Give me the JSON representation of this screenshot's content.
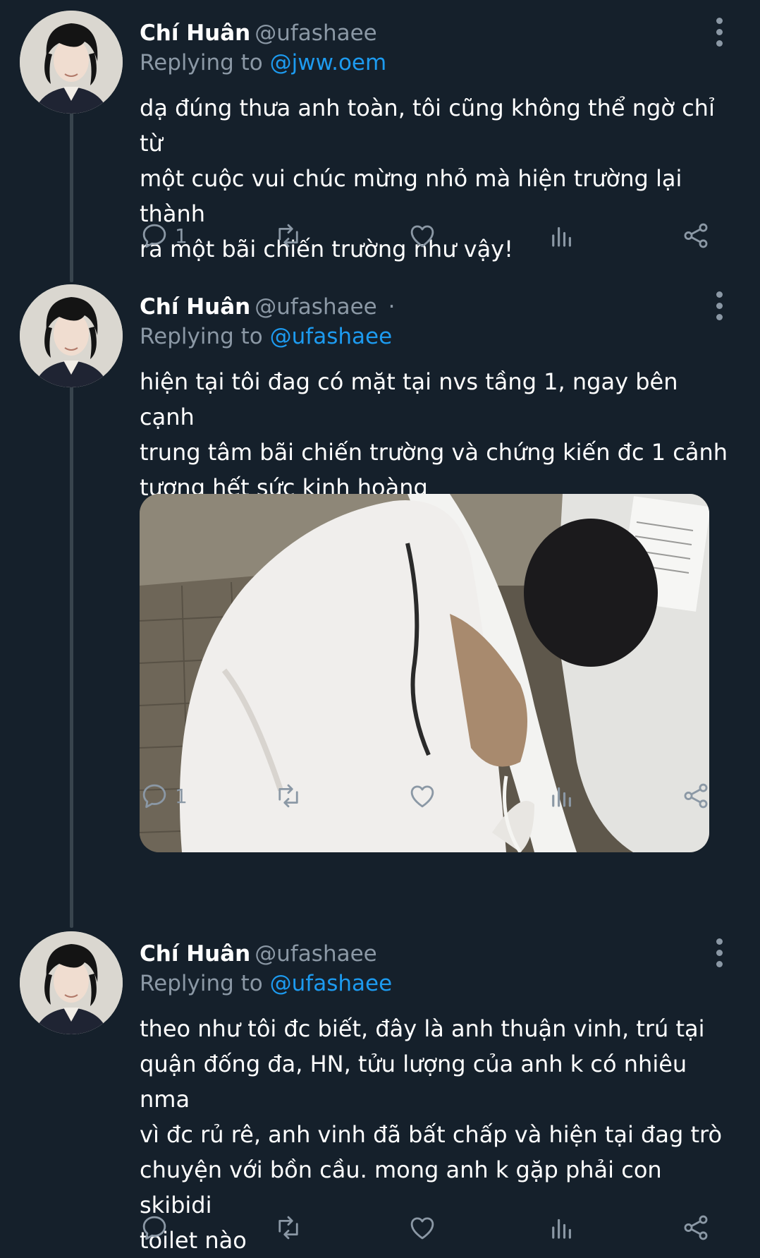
{
  "tweets": [
    {
      "name": "Chí Huân",
      "handle": "@ufashaee",
      "handle_suffix": "",
      "replying_prefix": "Replying to",
      "replying_to": "@jww.oem",
      "text_lines": [
        "dạ đúng thưa anh toàn, tôi cũng không thể ngờ chỉ từ",
        "một cuộc vui chúc mừng nhỏ mà hiện trường lại thành",
        "ra một bãi chiến trường như vậy!"
      ],
      "reply_count": "1"
    },
    {
      "name": "Chí Huân",
      "handle": "@ufashaee",
      "handle_suffix": "·",
      "replying_prefix": "Replying to",
      "replying_to": "@ufashaee",
      "text_lines": [
        "hiện tại tôi đag có mặt tại nvs tầng 1, ngay bên cạnh",
        "trung tâm bãi chiến trường và chứng kiến đc 1 cảnh",
        "tượng hết sức kinh hoàng"
      ],
      "reply_count": "1"
    },
    {
      "name": "Chí Huân",
      "handle": "@ufashaee",
      "handle_suffix": "",
      "replying_prefix": "Replying to",
      "replying_to": "@ufashaee",
      "text_lines": [
        "theo như tôi đc biết, đây là anh thuận vinh, trú tại",
        "quận đống đa, HN, tửu lượng của anh k có nhiêu nma",
        "vì đc rủ rê, anh vinh đã bất chấp và hiện tại đag trò",
        "chuyện với bồn cầu. mong anh k gặp phải con skibidi",
        "toilet nào"
      ],
      "reply_count": ""
    }
  ],
  "icons": {
    "reply": "reply-icon",
    "retweet": "retweet-icon",
    "like": "heart-icon",
    "views": "analytics-icon",
    "share": "share-icon",
    "more": "more-icon"
  },
  "colors": {
    "background": "#15202b",
    "secondary_text": "#8b98a5",
    "mention": "#1d9bf0",
    "thread_line": "#38444d"
  }
}
